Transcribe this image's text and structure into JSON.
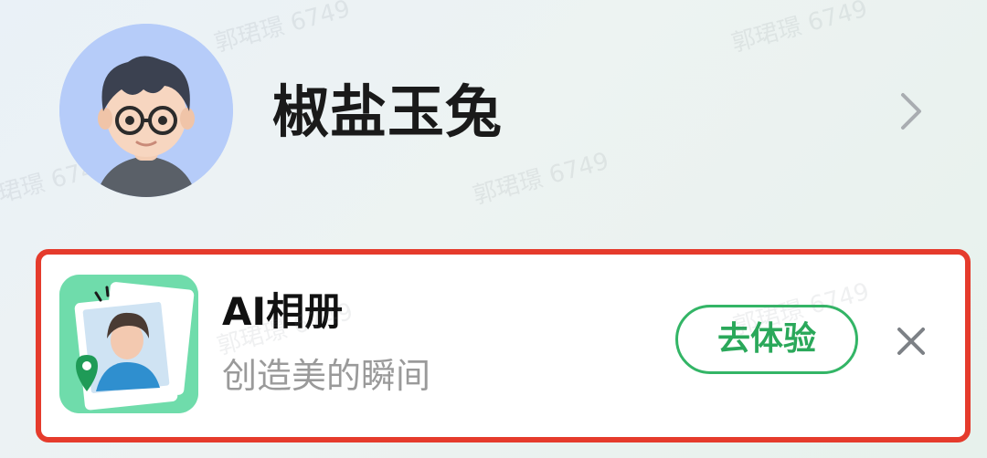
{
  "profile": {
    "name": "椒盐玉兔",
    "avatar_icon": "avatar-icon",
    "chevron_icon": "chevron-right-icon"
  },
  "card": {
    "title": "AI相册",
    "subtitle": "创造美的瞬间",
    "button_label": "去体验",
    "close_icon": "close-icon",
    "app_icon": "ai-album-app-icon",
    "highlight_color": "#e53b2c",
    "accent_color": "#2aa85a"
  },
  "watermark": {
    "text": "郭珺璟 6749"
  }
}
